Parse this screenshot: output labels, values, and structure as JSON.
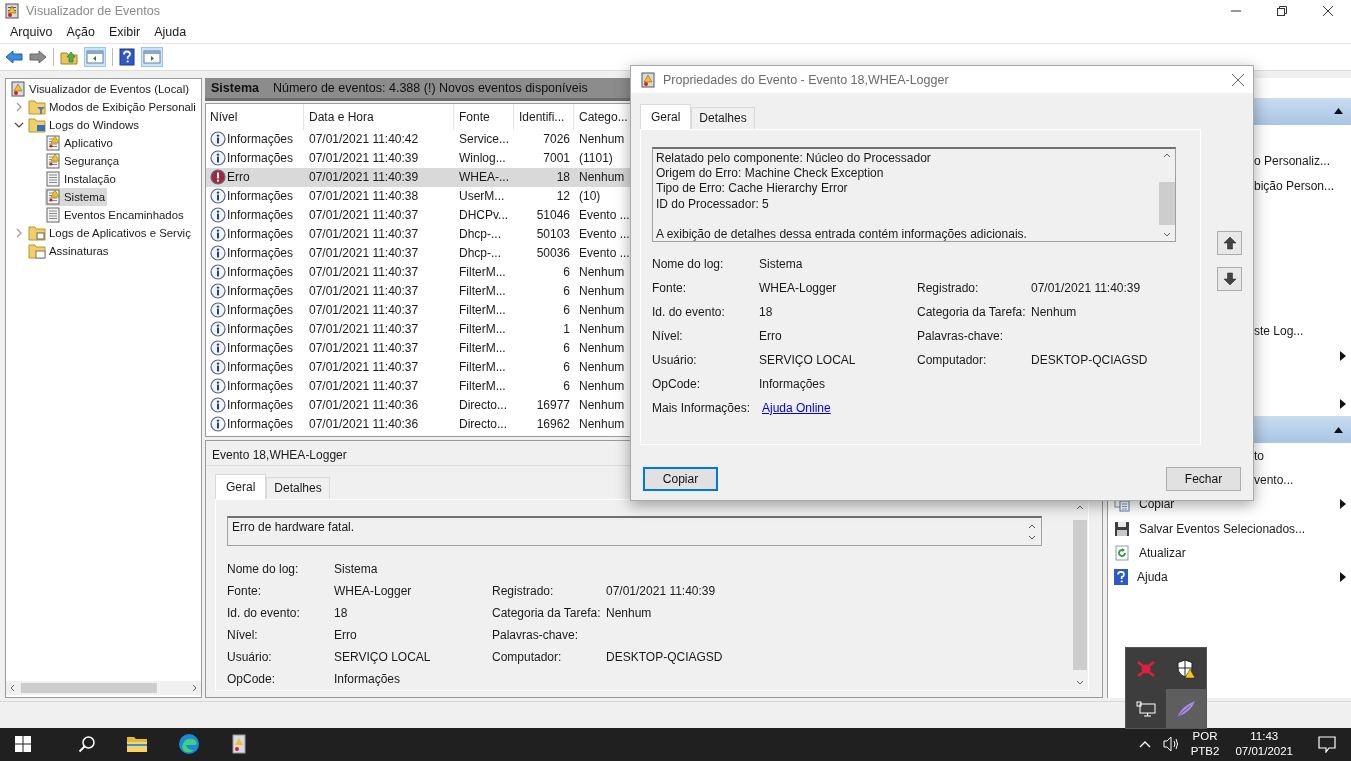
{
  "window": {
    "title": "Visualizador de Eventos"
  },
  "menu": [
    "Arquivo",
    "Ação",
    "Exibir",
    "Ajuda"
  ],
  "tree": {
    "label": "Visualizador de Eventos (Local)",
    "selected": false,
    "children": [
      {
        "label": "Modos de Exibição Personali",
        "kind": "folder-filter",
        "expanded": false,
        "selected": false
      },
      {
        "label": "Logs do Windows",
        "kind": "folder-windows",
        "expanded": true,
        "selected": false,
        "children": [
          {
            "label": "Aplicativo",
            "kind": "log-alert",
            "selected": false
          },
          {
            "label": "Segurança",
            "kind": "log-alert",
            "selected": false
          },
          {
            "label": "Instalação",
            "kind": "log",
            "selected": false
          },
          {
            "label": "Sistema",
            "kind": "log-alert",
            "selected": true
          },
          {
            "label": "Eventos Encaminhados",
            "kind": "log",
            "selected": false
          }
        ]
      },
      {
        "label": "Logs de Aplicativos e Serviç",
        "kind": "folder",
        "expanded": false,
        "selected": false
      },
      {
        "label": "Assinaturas",
        "kind": "folder-subscription",
        "selected": false
      }
    ]
  },
  "log_header": {
    "title": "Sistema",
    "summary": "Número de eventos: 4.388 (!) Novos eventos disponíveis"
  },
  "events": {
    "columns": [
      "Nível",
      "Data e Hora",
      "Fonte",
      "Identifi...",
      "Catego..."
    ],
    "rows": [
      {
        "kind": "info",
        "level": "Informações",
        "date": "07/01/2021 11:40:42",
        "source": "Service...",
        "id": "7026",
        "category": "Nenhum",
        "selected": false
      },
      {
        "kind": "info",
        "level": "Informações",
        "date": "07/01/2021 11:40:39",
        "source": "Winlog...",
        "id": "7001",
        "category": "(1101)",
        "selected": false
      },
      {
        "kind": "error",
        "level": "Erro",
        "date": "07/01/2021 11:40:39",
        "source": "WHEA-...",
        "id": "18",
        "category": "Nenhum",
        "selected": true
      },
      {
        "kind": "info",
        "level": "Informações",
        "date": "07/01/2021 11:40:38",
        "source": "UserM...",
        "id": "12",
        "category": "(10)",
        "selected": false
      },
      {
        "kind": "info",
        "level": "Informações",
        "date": "07/01/2021 11:40:37",
        "source": "DHCPv...",
        "id": "51046",
        "category": "Evento ...",
        "selected": false
      },
      {
        "kind": "info",
        "level": "Informações",
        "date": "07/01/2021 11:40:37",
        "source": "Dhcp-...",
        "id": "50103",
        "category": "Evento ...",
        "selected": false
      },
      {
        "kind": "info",
        "level": "Informações",
        "date": "07/01/2021 11:40:37",
        "source": "Dhcp-...",
        "id": "50036",
        "category": "Evento ...",
        "selected": false
      },
      {
        "kind": "info",
        "level": "Informações",
        "date": "07/01/2021 11:40:37",
        "source": "FilterM...",
        "id": "6",
        "category": "Nenhum",
        "selected": false
      },
      {
        "kind": "info",
        "level": "Informações",
        "date": "07/01/2021 11:40:37",
        "source": "FilterM...",
        "id": "6",
        "category": "Nenhum",
        "selected": false
      },
      {
        "kind": "info",
        "level": "Informações",
        "date": "07/01/2021 11:40:37",
        "source": "FilterM...",
        "id": "6",
        "category": "Nenhum",
        "selected": false
      },
      {
        "kind": "info",
        "level": "Informações",
        "date": "07/01/2021 11:40:37",
        "source": "FilterM...",
        "id": "1",
        "category": "Nenhum",
        "selected": false
      },
      {
        "kind": "info",
        "level": "Informações",
        "date": "07/01/2021 11:40:37",
        "source": "FilterM...",
        "id": "6",
        "category": "Nenhum",
        "selected": false
      },
      {
        "kind": "info",
        "level": "Informações",
        "date": "07/01/2021 11:40:37",
        "source": "FilterM...",
        "id": "6",
        "category": "Nenhum",
        "selected": false
      },
      {
        "kind": "info",
        "level": "Informações",
        "date": "07/01/2021 11:40:37",
        "source": "FilterM...",
        "id": "6",
        "category": "Nenhum",
        "selected": false
      },
      {
        "kind": "info",
        "level": "Informações",
        "date": "07/01/2021 11:40:36",
        "source": "Directo...",
        "id": "16977",
        "category": "Nenhum",
        "selected": false
      },
      {
        "kind": "info",
        "level": "Informações",
        "date": "07/01/2021 11:40:36",
        "source": "Directo...",
        "id": "16962",
        "category": "Nenhum",
        "selected": false
      }
    ]
  },
  "detail_pane": {
    "title": "Evento 18,WHEA-Logger",
    "tabs": [
      {
        "label": "Geral",
        "selected": true
      },
      {
        "label": "Detalhes",
        "selected": false
      }
    ],
    "description": "Erro de hardware fatal.",
    "fields": [
      [
        {
          "label": "Nome do log:",
          "value": "Sistema"
        }
      ],
      [
        {
          "label": "Fonte:",
          "value": "WHEA-Logger"
        },
        {
          "label": "Registrado:",
          "value": "07/01/2021 11:40:39"
        }
      ],
      [
        {
          "label": "Id. do evento:",
          "value": "18"
        },
        {
          "label": "Categoria da Tarefa:",
          "value": "Nenhum"
        }
      ],
      [
        {
          "label": "Nível:",
          "value": "Erro"
        },
        {
          "label": "Palavras-chave:"
        }
      ],
      [
        {
          "label": "Usuário:",
          "value": "SERVIÇO LOCAL"
        },
        {
          "label": "Computador:",
          "value": "DESKTOP-QCIAGSD"
        }
      ],
      [
        {
          "label": "OpCode:",
          "value": "Informações"
        }
      ]
    ]
  },
  "actions": [
    {
      "kind": "header"
    },
    {
      "kind": "covered"
    },
    {
      "kind": "partial",
      "label": "o Personaliz..."
    },
    {
      "kind": "partial",
      "label": "bição Person..."
    },
    {
      "kind": "covered"
    },
    {
      "kind": "covered"
    },
    {
      "kind": "covered"
    },
    {
      "kind": "covered"
    },
    {
      "kind": "covered"
    },
    {
      "kind": "partial",
      "label": "ste Log..."
    },
    {
      "kind": "covered",
      "submenu": true
    },
    {
      "kind": "covered"
    },
    {
      "kind": "covered",
      "submenu": true
    },
    {
      "kind": "header"
    },
    {
      "kind": "partial",
      "label": "to"
    },
    {
      "kind": "partial",
      "label": "vento..."
    },
    {
      "kind": "copy",
      "label": "Copiar",
      "submenu": true
    },
    {
      "kind": "save",
      "label": "Salvar Eventos Selecionados..."
    },
    {
      "kind": "refresh",
      "label": "Atualizar"
    },
    {
      "kind": "help",
      "label": "Ajuda",
      "submenu": true
    }
  ],
  "dialog": {
    "title": "Propriedades do Evento - Evento 18,WHEA-Logger",
    "tabs": [
      {
        "label": "Geral",
        "selected": true
      },
      {
        "label": "Detalhes",
        "selected": false
      }
    ],
    "description": [
      [
        "Relatado pelo componente: Núcleo do Processador",
        "Origem do Erro: Machine Check Exception",
        "Tipo de Erro: Cache Hierarchy Error",
        "ID do Processador: 5"
      ],
      [
        "A exibição de detalhes dessa entrada contém informações adicionais."
      ]
    ],
    "fields": [
      [
        {
          "label": "Nome do log:",
          "value": "Sistema"
        }
      ],
      [
        {
          "label": "Fonte:",
          "value": "WHEA-Logger"
        },
        {
          "label": "Registrado:",
          "value": "07/01/2021 11:40:39"
        }
      ],
      [
        {
          "label": "Id. do evento:",
          "value": "18"
        },
        {
          "label": "Categoria da Tarefa:",
          "value": "Nenhum"
        }
      ],
      [
        {
          "label": "Nível:",
          "value": "Erro"
        },
        {
          "label": "Palavras-chave:"
        }
      ],
      [
        {
          "label": "Usuário:",
          "value": "SERVIÇO LOCAL"
        },
        {
          "label": "Computador:",
          "value": "DESKTOP-QCIAGSD"
        }
      ],
      [
        {
          "label": "OpCode:",
          "value": "Informações"
        }
      ],
      [
        {
          "label": "Mais Informações:",
          "value": "Ajuda Online",
          "link": true
        }
      ]
    ],
    "buttons": [
      {
        "label": "Copiar",
        "focused": true
      },
      {
        "label": "Fechar",
        "focused": false
      }
    ]
  },
  "taskbar": {
    "language": "POR",
    "layout": "PTB2",
    "time": "11:43",
    "date": "07/01/2021"
  }
}
